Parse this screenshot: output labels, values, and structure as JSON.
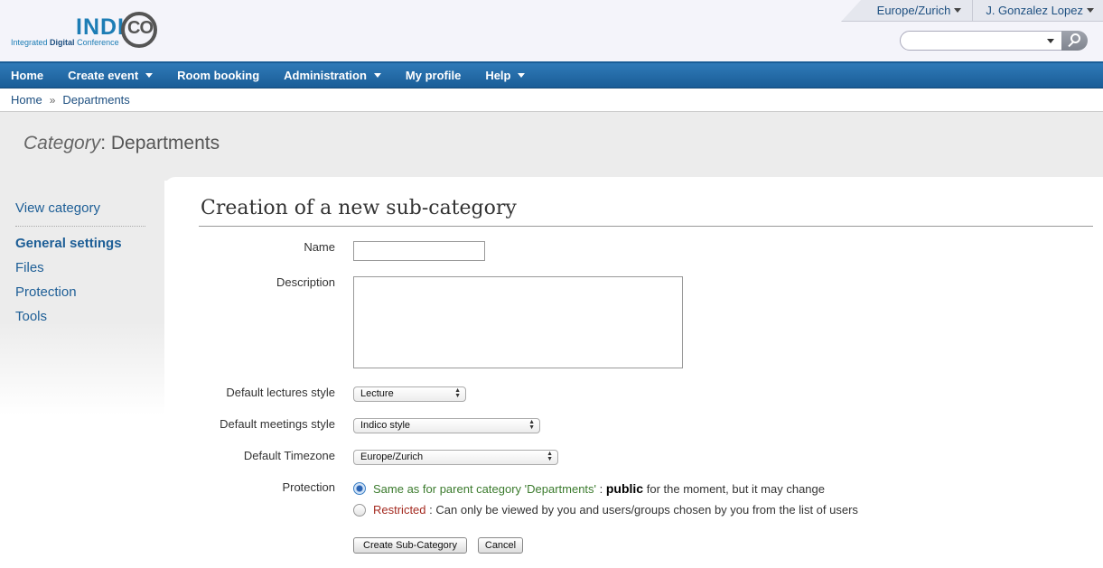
{
  "logo": {
    "word": "INDI",
    "co": "CO",
    "subtitle_prefix": "Integrated",
    "subtitle_bold": "Digital",
    "subtitle_suffix": "Conference"
  },
  "header": {
    "timezone": "Europe/Zurich",
    "user": "J. Gonzalez Lopez",
    "search": {
      "value": ""
    }
  },
  "nav": [
    {
      "label": "Home",
      "dropdown": false
    },
    {
      "label": "Create event",
      "dropdown": true
    },
    {
      "label": "Room booking",
      "dropdown": false
    },
    {
      "label": "Administration",
      "dropdown": true
    },
    {
      "label": "My profile",
      "dropdown": false
    },
    {
      "label": "Help",
      "dropdown": true
    }
  ],
  "breadcrumb": {
    "home": "Home",
    "separator": "»",
    "current": "Departments"
  },
  "category": {
    "prefix": "Category",
    "name": ": Departments"
  },
  "sidebar": {
    "view_category": "View category",
    "items": [
      "General settings",
      "Files",
      "Protection",
      "Tools"
    ],
    "active": "General settings"
  },
  "form": {
    "heading": "Creation of a new sub-category",
    "name_label": "Name",
    "description_label": "Description",
    "lectures_label": "Default lectures style",
    "lectures_value": "Lecture",
    "meetings_label": "Default meetings style",
    "meetings_value": "Indico style",
    "timezone_label": "Default Timezone",
    "timezone_value": "Europe/Zurich",
    "protection_label": "Protection",
    "protection_options": [
      {
        "label": "Same as for parent category 'Departments'",
        "sep": " : ",
        "bold": "public",
        "rest": " for the moment, but it may change",
        "checked": true
      },
      {
        "label": "Restricted",
        "sep": " : ",
        "rest": "Can only be viewed by you and users/groups chosen by you from the list of users",
        "checked": false
      }
    ],
    "create_button": "Create Sub-Category",
    "cancel_button": "Cancel"
  },
  "colors": {
    "nav": "#2a72b0",
    "link": "#1d5e96",
    "green_text": "#3a7a2c",
    "red_text": "#a42a20"
  },
  "icons": [
    "search-icon",
    "chevron-down-icon",
    "radio-icon"
  ]
}
